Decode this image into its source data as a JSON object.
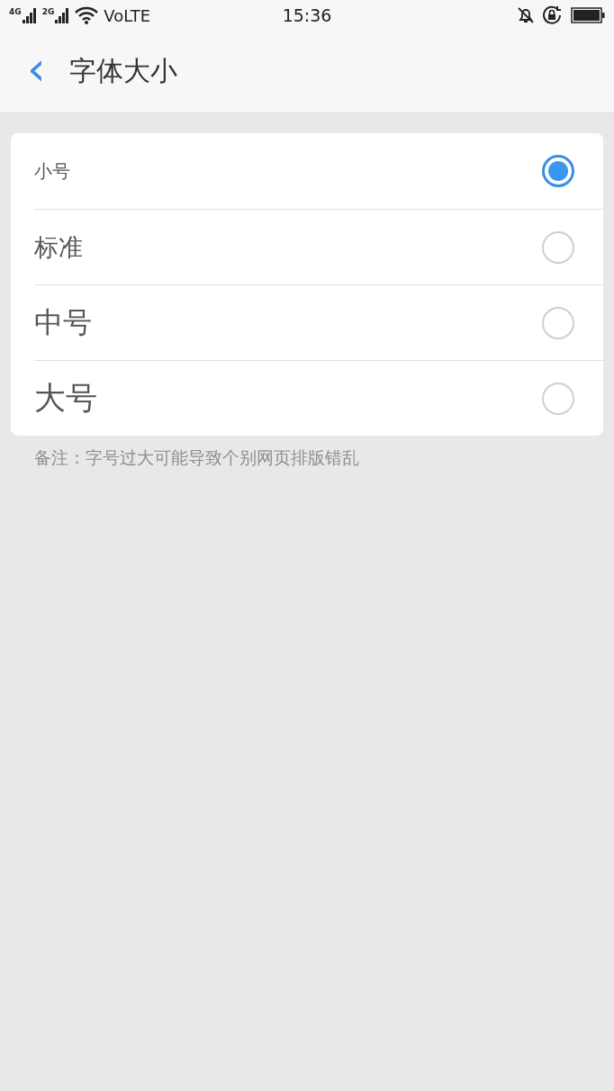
{
  "status_bar": {
    "signals": [
      {
        "label": "4G"
      },
      {
        "label": "2G"
      }
    ],
    "network": "VoLTE",
    "time": "15:36"
  },
  "header": {
    "back": "‹",
    "title": "字体大小"
  },
  "options": [
    {
      "label": "小号",
      "selected": true
    },
    {
      "label": "标准",
      "selected": false
    },
    {
      "label": "中号",
      "selected": false
    },
    {
      "label": "大号",
      "selected": false
    }
  ],
  "note": "备注：字号过大可能导致个别网页排版错乱"
}
